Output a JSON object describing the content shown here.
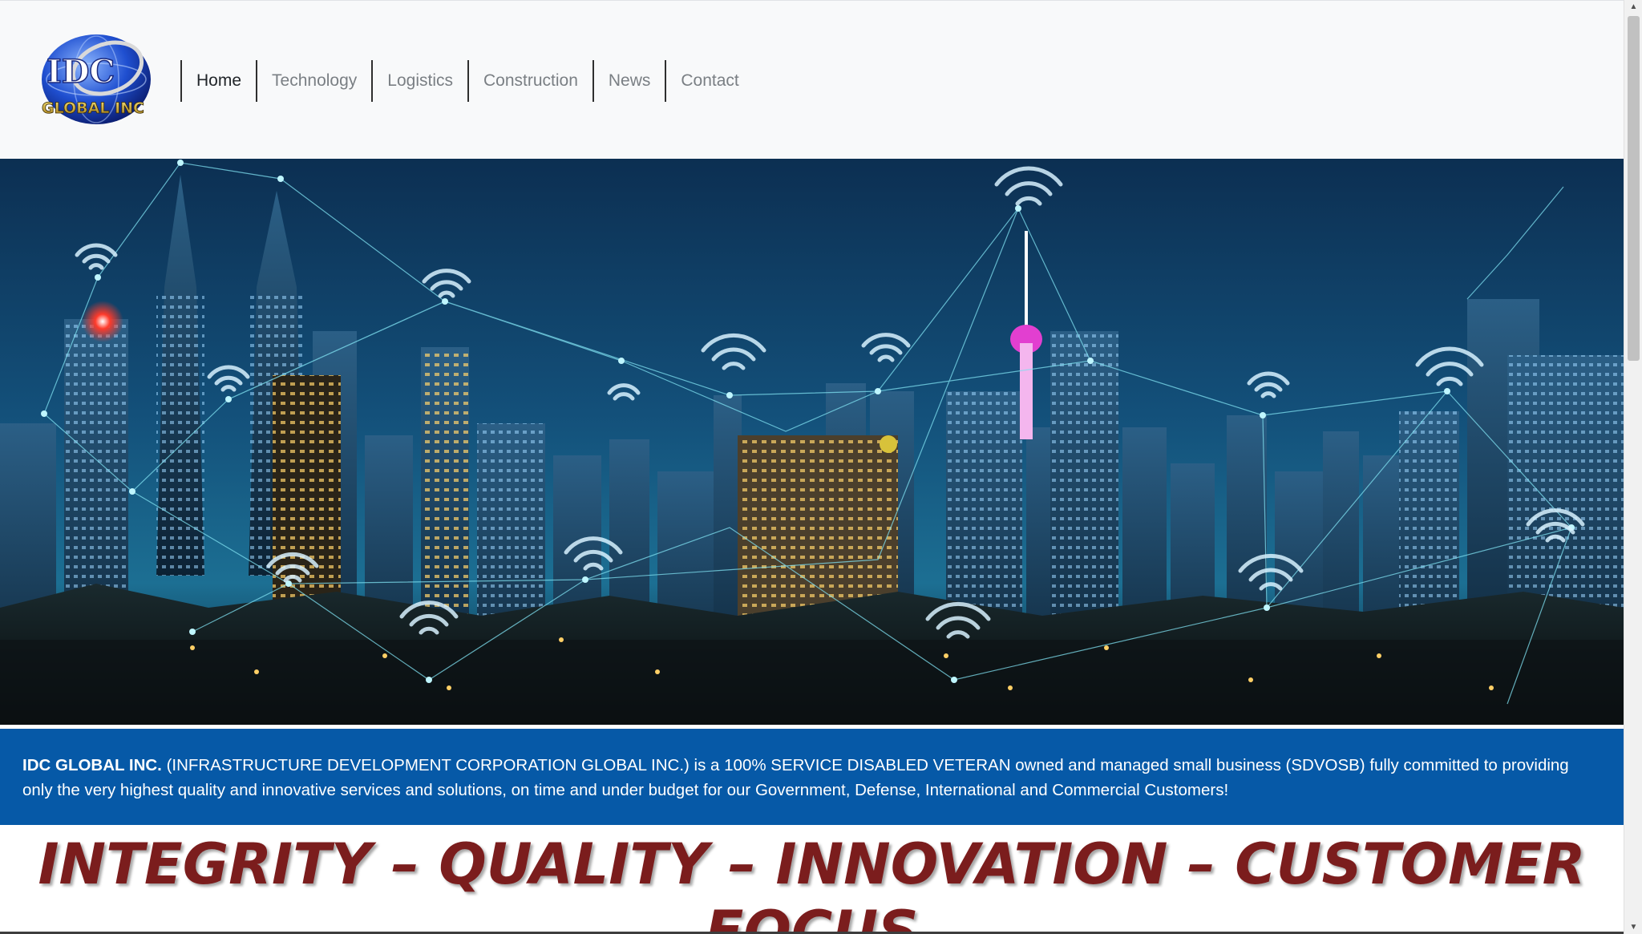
{
  "site": {
    "logo_text_top": "IDC",
    "logo_text_bottom": "GLOBAL INC"
  },
  "nav": {
    "items": [
      {
        "label": "Home",
        "active": true
      },
      {
        "label": "Technology",
        "active": false
      },
      {
        "label": "Logistics",
        "active": false
      },
      {
        "label": "Construction",
        "active": false
      },
      {
        "label": "News",
        "active": false
      },
      {
        "label": "Contact",
        "active": false
      }
    ]
  },
  "intro": {
    "company": "IDC GLOBAL INC.",
    "text": " (INFRASTRUCTURE DEVELOPMENT CORPORATION GLOBAL INC.) is a 100% SERVICE DISABLED VETERAN owned and managed small business (SDVOSB) fully committed to providing only the very highest quality and innovative services and solutions, on time and under budget for our Government, Defense, International and Commercial Customers!"
  },
  "motto": "INTEGRITY – QUALITY – INNOVATION – CUSTOMER FOCUS",
  "colors": {
    "header_bg": "#f8f9fa",
    "band_bg": "#0659a7",
    "motto": "#7b1d1d"
  }
}
